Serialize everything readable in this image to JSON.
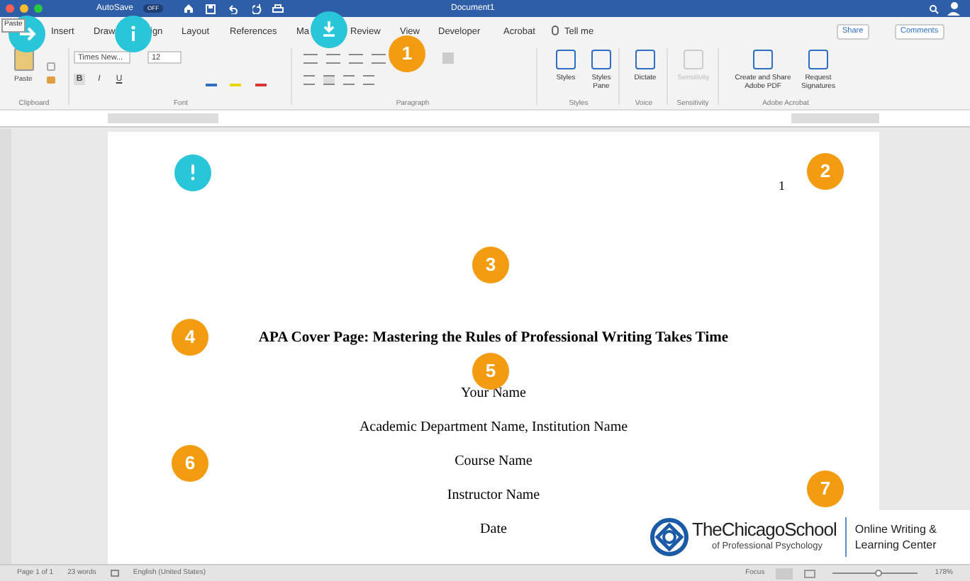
{
  "window": {
    "title": "Document1",
    "autosave_label": "AutoSave",
    "autosave_state": "OFF",
    "tooltip": "Paste"
  },
  "tabs": [
    {
      "label": "Insert",
      "selected": false
    },
    {
      "label": "Draw",
      "selected": false
    },
    {
      "label": "ign",
      "selected": false
    },
    {
      "label": "Layout",
      "selected": false
    },
    {
      "label": "References",
      "selected": false
    },
    {
      "label": "Ma",
      "selected": false
    },
    {
      "label": "Review",
      "selected": false
    },
    {
      "label": "View",
      "selected": false
    },
    {
      "label": "Developer",
      "selected": false
    },
    {
      "label": "Acrobat",
      "selected": false
    }
  ],
  "tell_me": "Tell me",
  "share": "Share",
  "comments": "Comments",
  "ribbon": {
    "paste": "Paste",
    "font_name": "Times New...",
    "font_size": "12",
    "format_buttons": [
      "B",
      "I",
      "U"
    ],
    "groups": [
      "Clipboard",
      "Font",
      "Paragraph",
      "Styles",
      "Voice",
      "Sensitivity",
      "Adobe Acrobat"
    ],
    "big_buttons": [
      {
        "label": "Styles",
        "disabled": false
      },
      {
        "label": "Styles Pane",
        "disabled": false
      },
      {
        "label": "Dictate",
        "disabled": false
      },
      {
        "label": "Sensitivity",
        "disabled": true
      },
      {
        "label": "Create and Share Adobe PDF",
        "disabled": false
      },
      {
        "label": "Request Signatures",
        "disabled": false
      }
    ]
  },
  "document": {
    "page_number": "1",
    "title": "APA Cover Page: Mastering the Rules of Professional Writing Takes Time",
    "lines": [
      "Your Name",
      "Academic Department Name, Institution Name",
      "Course Name",
      "Instructor Name",
      "Date"
    ]
  },
  "callouts": [
    {
      "kind": "icon"
    },
    {
      "kind": "icon"
    },
    {
      "kind": "icon"
    },
    {
      "kind": "icon"
    },
    {
      "kind": "number",
      "label": "1"
    },
    {
      "kind": "number",
      "label": "2"
    },
    {
      "kind": "number",
      "label": "3"
    },
    {
      "kind": "number",
      "label": "4"
    },
    {
      "kind": "number",
      "label": "5"
    },
    {
      "kind": "number",
      "label": "6"
    },
    {
      "kind": "number",
      "label": "7"
    }
  ],
  "logo": {
    "name": "TheChicagoSchool",
    "subtitle": "of Professional Psychology",
    "unit_line_1": "Online Writing &",
    "unit_line_2": "Learning Center"
  },
  "status_bar": {
    "page": "Page 1 of 1",
    "words": "23 words",
    "language": "English (United States)",
    "focus": "Focus",
    "zoom_slider": {
      "level": 0.55
    },
    "zoom": "178%"
  }
}
